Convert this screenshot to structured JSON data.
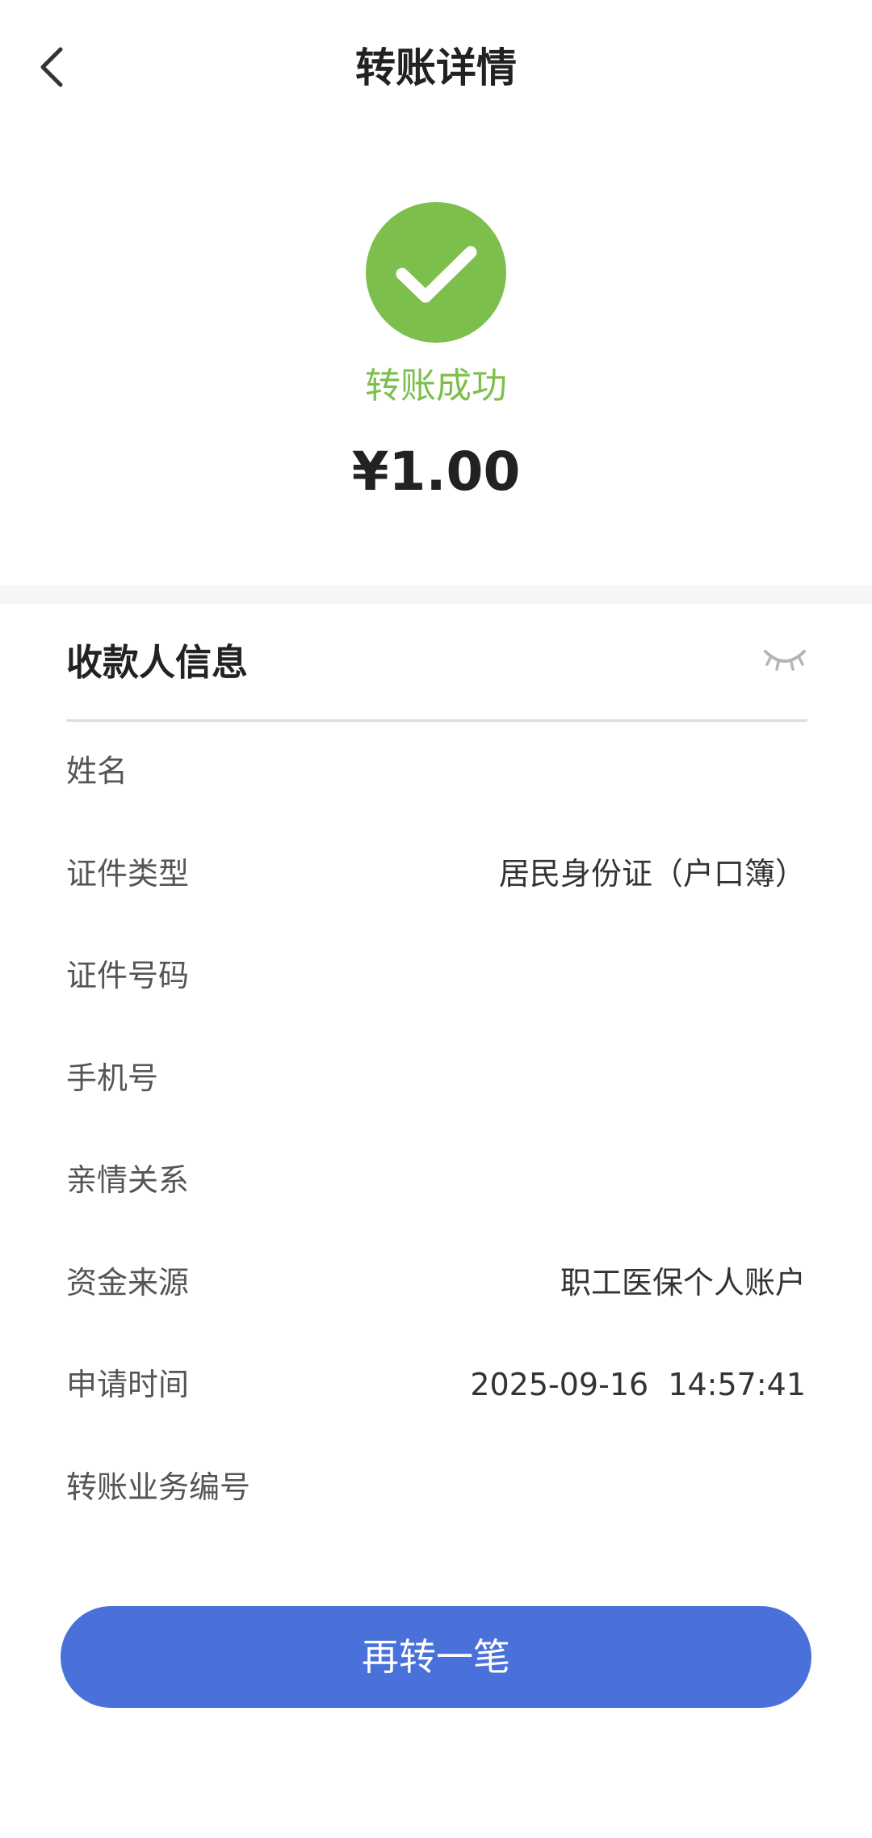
{
  "header": {
    "title": "转账详情",
    "back_icon": "chevron-left-icon"
  },
  "result": {
    "status_icon": "check-circle-icon",
    "status_color": "#7cbf4c",
    "status_text": "转账成功",
    "amount": "¥1.00"
  },
  "payee": {
    "title": "收款人信息",
    "visibility_icon": "eye-closed-icon",
    "rows": [
      {
        "label": "姓名",
        "value": ""
      },
      {
        "label": "证件类型",
        "value": "居民身份证（户口簿）"
      },
      {
        "label": "证件号码",
        "value": ""
      },
      {
        "label": "手机号",
        "value": ""
      },
      {
        "label": "亲情关系",
        "value": ""
      },
      {
        "label": "资金来源",
        "value": "职工医保个人账户"
      },
      {
        "label": "申请时间",
        "value": "2025-09-16  14:57:41"
      },
      {
        "label": "转账业务编号",
        "value": ""
      }
    ]
  },
  "actions": {
    "again_label": "再转一笔",
    "accent_color": "#4a70d9"
  }
}
